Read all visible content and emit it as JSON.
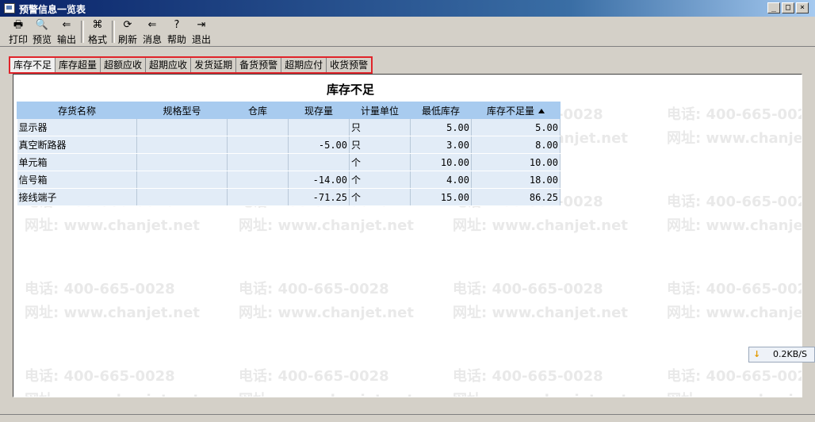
{
  "window": {
    "title": "预警信息一览表"
  },
  "toolbar": {
    "print": "打印",
    "preview": "预览",
    "export": "输出",
    "format": "格式",
    "refresh": "刷新",
    "message": "消息",
    "help": "帮助",
    "exit": "退出"
  },
  "tabs": [
    "库存不足",
    "库存超量",
    "超额应收",
    "超期应收",
    "发货延期",
    "备货预警",
    "超期应付",
    "收货预警"
  ],
  "report": {
    "title": "库存不足",
    "columns": [
      "存货名称",
      "规格型号",
      "仓库",
      "现存量",
      "计量单位",
      "最低库存",
      "库存不足量"
    ],
    "rows": [
      [
        "显示器",
        "",
        "",
        "",
        "只",
        "5.00",
        "5.00"
      ],
      [
        "真空断路器",
        "",
        "",
        "-5.00",
        "只",
        "3.00",
        "8.00"
      ],
      [
        "单元箱",
        "",
        "",
        "",
        "个",
        "10.00",
        "10.00"
      ],
      [
        "信号箱",
        "",
        "",
        "-14.00",
        "个",
        "4.00",
        "18.00"
      ],
      [
        "接线端子",
        "",
        "",
        "-71.25",
        "个",
        "15.00",
        "86.25"
      ]
    ]
  },
  "watermark": {
    "phone": "电话: 400-665-0028",
    "site": "网址: www.chanjet.net"
  },
  "speed": {
    "value": "0.2KB/S"
  },
  "colors": {
    "header_bg": "#a8cbef",
    "row_bg": "#e2ecf7",
    "tab_highlight": "#e0242a"
  }
}
